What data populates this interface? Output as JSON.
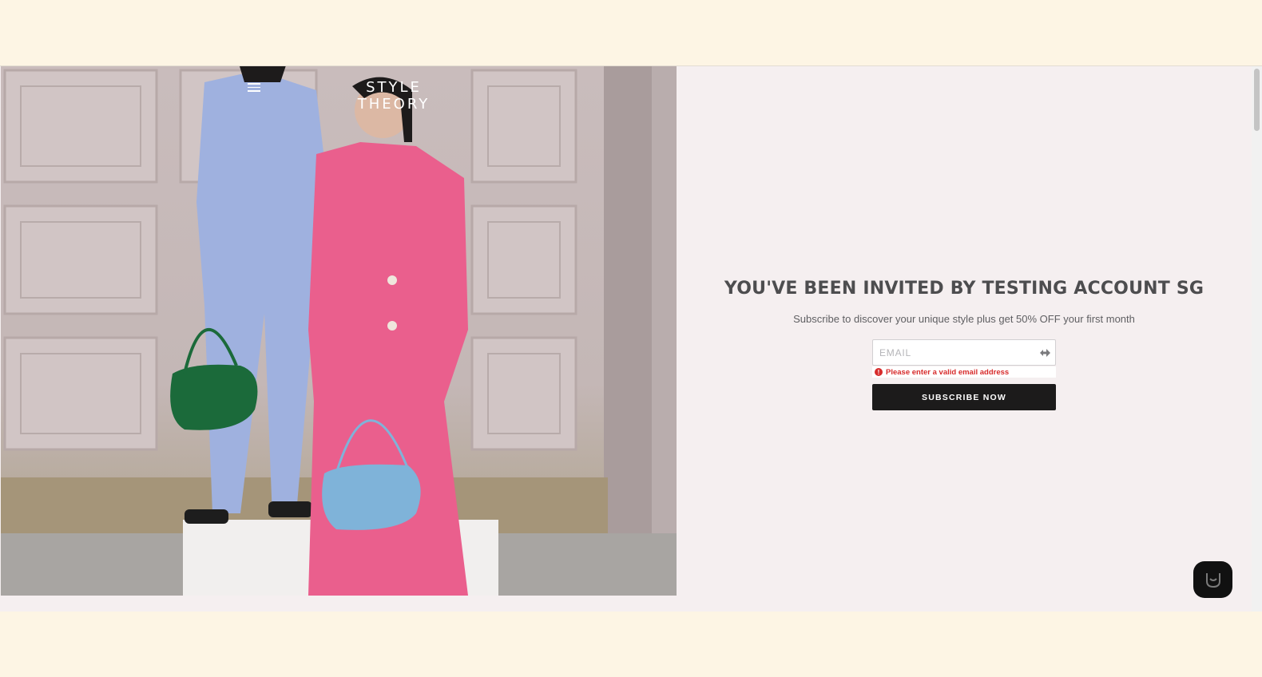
{
  "header": {
    "brand": "STYLE THEORY",
    "menu_icon": "hamburger-menu-icon"
  },
  "invite": {
    "title": "YOU'VE BEEN INVITED BY TESTING ACCOUNT SG",
    "subtitle": "Subscribe to discover your unique style plus get 50% OFF your first month",
    "email": {
      "placeholder": "EMAIL",
      "value": "",
      "submit_icon": "arrow-submit-icon"
    },
    "error": {
      "icon": "exclamation-circle-icon",
      "text": "Please enter a valid email address"
    },
    "subscribe_label": "SUBSCRIBE NOW"
  },
  "chat": {
    "icon": "chat-smile-icon"
  },
  "colors": {
    "page_background": "#fdf5e4",
    "panel_background": "#f5eff0",
    "button_background": "#1c1b1b",
    "error": "#d72b2b",
    "title_text": "#4d4d4f"
  }
}
